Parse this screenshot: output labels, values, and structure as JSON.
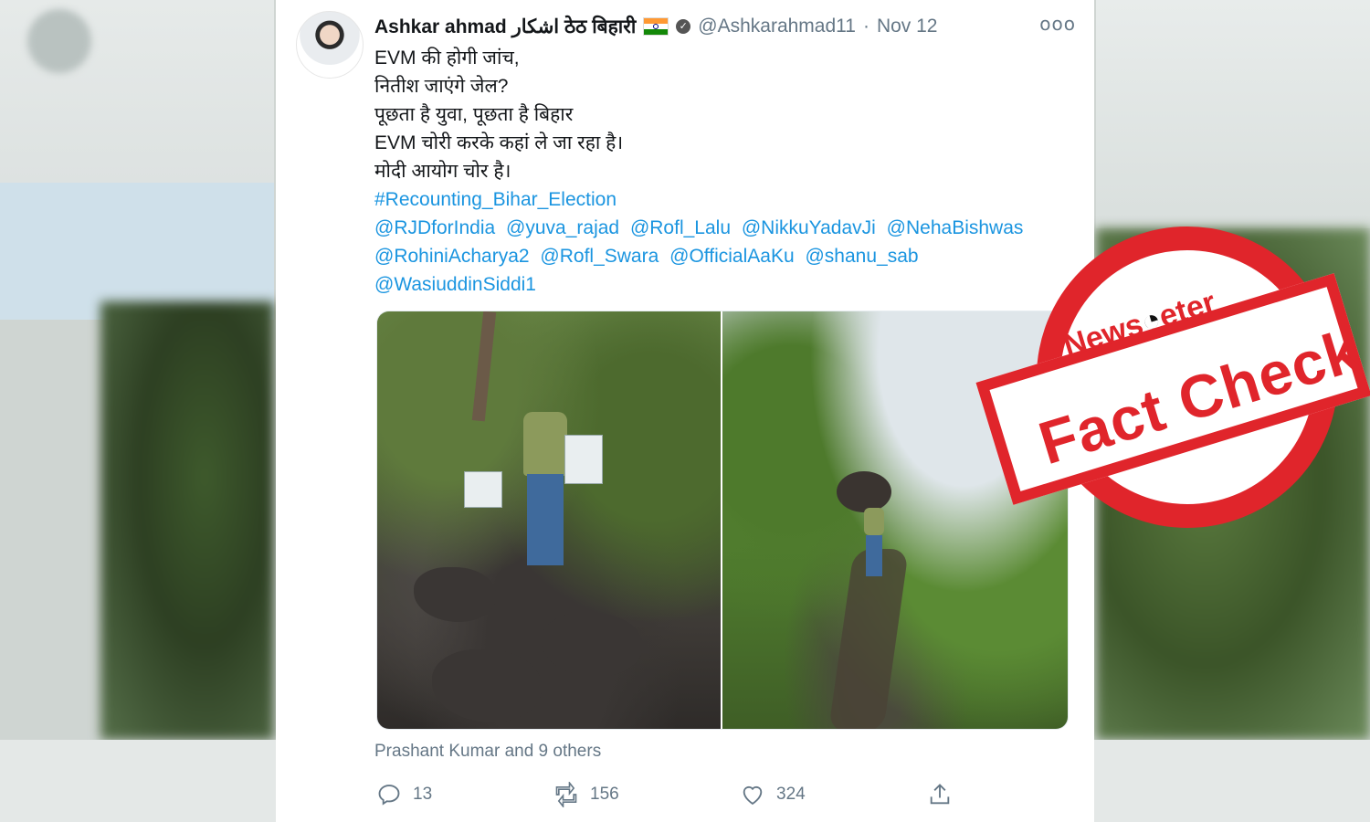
{
  "tweet": {
    "display_name": "Ashkar ahmad اشکار ठेठ बिहारी",
    "handle": "@Ashkarahmad11",
    "separator": "·",
    "date": "Nov 12",
    "more_label": "ooo",
    "lines": [
      "EVM की होगी जांच,",
      "नितीश जाएंगे जेल?",
      "पूछता है युवा, पूछता है बिहार",
      "EVM चोरी करके कहां ले जा रहा है।",
      "मोदी आयोग चोर है।"
    ],
    "hashtag": "#Recounting_Bihar_Election",
    "mentions_row1": [
      "@RJDforIndia",
      "@yuva_rajad",
      "@Rofl_Lalu",
      "@NikkuYadavJi",
      "@NehaBishwas"
    ],
    "mentions_row2": [
      "@RohiniAcharya2",
      "@Rofl_Swara",
      "@OfficialAaKu",
      "@shanu_sab"
    ],
    "mentions_row3": [
      "@WasiuddinSiddi1"
    ],
    "liked_by": "Prashant Kumar and 9 others",
    "counts": {
      "replies": "13",
      "retweets": "156",
      "likes": "324"
    }
  },
  "icons": {
    "reply": "reply-icon",
    "retweet": "retweet-icon",
    "like": "heart-icon",
    "share": "share-icon",
    "verified": "verified-icon",
    "flag": "india-flag-icon"
  },
  "stamp": {
    "logo_prefix": "News",
    "logo_suffix": "eter",
    "label": "Fact Check"
  },
  "colors": {
    "link": "#1b95e0",
    "stamp_red": "#e0252b",
    "muted": "#657786"
  }
}
